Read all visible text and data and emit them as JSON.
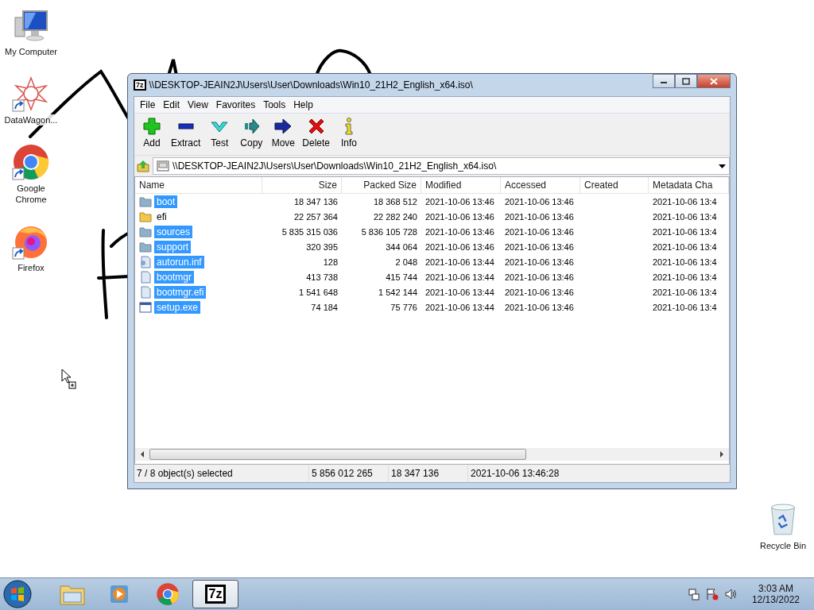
{
  "desktop_icons": [
    {
      "label": "My Computer",
      "kind": "computer",
      "shortcut": false
    },
    {
      "label": "DataWagon...",
      "kind": "star",
      "shortcut": true
    },
    {
      "label": "Google Chrome",
      "kind": "chrome",
      "shortcut": true
    },
    {
      "label": "Firefox",
      "kind": "firefox",
      "shortcut": true
    }
  ],
  "recycle_bin": {
    "label": "Recycle Bin"
  },
  "window": {
    "title": "\\\\DESKTOP-JEAIN2J\\Users\\User\\Downloads\\Win10_21H2_English_x64.iso\\",
    "badge": "7z"
  },
  "menu": [
    "File",
    "Edit",
    "View",
    "Favorites",
    "Tools",
    "Help"
  ],
  "toolbar": [
    {
      "label": "Add",
      "kind": "add"
    },
    {
      "label": "Extract",
      "kind": "extract"
    },
    {
      "label": "Test",
      "kind": "test"
    },
    {
      "label": "Copy",
      "kind": "copy"
    },
    {
      "label": "Move",
      "kind": "move"
    },
    {
      "label": "Delete",
      "kind": "delete"
    },
    {
      "label": "Info",
      "kind": "info"
    }
  ],
  "address": "\\\\DESKTOP-JEAIN2J\\Users\\User\\Downloads\\Win10_21H2_English_x64.iso\\",
  "columns": [
    "Name",
    "Size",
    "Packed Size",
    "Modified",
    "Accessed",
    "Created",
    "Metadata Cha"
  ],
  "rows": [
    {
      "name": "boot",
      "kind": "folder",
      "selected": true,
      "size": "18 347 136",
      "packed": "18 368 512",
      "modified": "2021-10-06 13:46",
      "accessed": "2021-10-06 13:46",
      "metadata": "2021-10-06 13:4"
    },
    {
      "name": "efi",
      "kind": "folder",
      "selected": false,
      "size": "22 257 364",
      "packed": "22 282 240",
      "modified": "2021-10-06 13:46",
      "accessed": "2021-10-06 13:46",
      "metadata": "2021-10-06 13:4"
    },
    {
      "name": "sources",
      "kind": "folder",
      "selected": true,
      "size": "5 835 315 036",
      "packed": "5 836 105 728",
      "modified": "2021-10-06 13:46",
      "accessed": "2021-10-06 13:46",
      "metadata": "2021-10-06 13:4"
    },
    {
      "name": "support",
      "kind": "folder",
      "selected": true,
      "size": "320 395",
      "packed": "344 064",
      "modified": "2021-10-06 13:46",
      "accessed": "2021-10-06 13:46",
      "metadata": "2021-10-06 13:4"
    },
    {
      "name": "autorun.inf",
      "kind": "settings",
      "selected": true,
      "size": "128",
      "packed": "2 048",
      "modified": "2021-10-06 13:44",
      "accessed": "2021-10-06 13:46",
      "metadata": "2021-10-06 13:4"
    },
    {
      "name": "bootmgr",
      "kind": "file",
      "selected": true,
      "size": "413 738",
      "packed": "415 744",
      "modified": "2021-10-06 13:44",
      "accessed": "2021-10-06 13:46",
      "metadata": "2021-10-06 13:4"
    },
    {
      "name": "bootmgr.efi",
      "kind": "file",
      "selected": true,
      "size": "1 541 648",
      "packed": "1 542 144",
      "modified": "2021-10-06 13:44",
      "accessed": "2021-10-06 13:46",
      "metadata": "2021-10-06 13:4"
    },
    {
      "name": "setup.exe",
      "kind": "program",
      "selected": true,
      "size": "74 184",
      "packed": "75 776",
      "modified": "2021-10-06 13:44",
      "accessed": "2021-10-06 13:46",
      "metadata": "2021-10-06 13:4"
    }
  ],
  "status_bar": [
    "7 / 8 object(s) selected",
    "5 856 012 265",
    "18 347 136",
    "2021-10-06 13:46:28"
  ],
  "taskbar": {
    "apps": [
      {
        "kind": "explorer",
        "selected": false
      },
      {
        "kind": "media",
        "selected": false
      },
      {
        "kind": "chrome",
        "selected": false
      },
      {
        "kind": "sevenzip",
        "label": "7z",
        "selected": true
      }
    ],
    "time": "3:03 AM",
    "date": "12/13/2022"
  }
}
